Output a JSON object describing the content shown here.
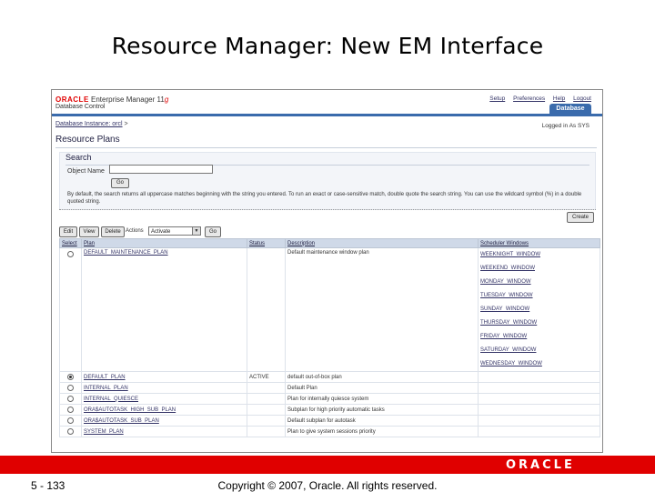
{
  "slide": {
    "title": "Resource Manager: New EM Interface",
    "page_number": "5 - 133",
    "copyright": "Copyright © 2007, Oracle. All rights reserved.",
    "footer_logo": "ORACLE"
  },
  "em": {
    "logo_oracle": "ORACLE",
    "logo_product": "Enterprise Manager 11",
    "logo_version": "g",
    "subtitle": "Database Control",
    "global_links": [
      "Setup",
      "Preferences",
      "Help",
      "Logout"
    ],
    "tab_label": "Database",
    "breadcrumb_link": "Database Instance: orcl",
    "breadcrumb_sep": ">",
    "logged_in": "Logged in As SYS",
    "page_title": "Resource Plans"
  },
  "search": {
    "heading": "Search",
    "name_label": "Object Name",
    "name_value": "",
    "go_label": "Go",
    "help_text": "By default, the search returns all uppercase matches beginning with the string you entered. To run an exact or case-sensitive match, double quote the search string. You can use the wildcard symbol (%) in a double quoted string."
  },
  "toolbar": {
    "create_label": "Create",
    "edit_label": "Edit",
    "view_label": "View",
    "delete_label": "Delete",
    "actions_label": "Actions",
    "actions_value": "Activate",
    "go_label": "Go"
  },
  "table": {
    "headers": [
      "Select",
      "Plan",
      "Status",
      "Description",
      "Scheduler Windows"
    ],
    "rows": [
      {
        "plan": "DEFAULT_MAINTENANCE_PLAN",
        "status": "",
        "description": "Default maintenance window plan",
        "windows": [
          "WEEKNIGHT_WINDOW",
          "WEEKEND_WINDOW",
          "MONDAY_WINDOW",
          "TUESDAY_WINDOW",
          "SUNDAY_WINDOW",
          "THURSDAY_WINDOW",
          "FRIDAY_WINDOW",
          "SATURDAY_WINDOW",
          "WEDNESDAY_WINDOW"
        ],
        "selected": false
      },
      {
        "plan": "DEFAULT_PLAN",
        "status": "ACTIVE",
        "description": "default out-of-box plan",
        "windows": [],
        "selected": true
      },
      {
        "plan": "INTERNAL_PLAN",
        "status": "",
        "description": "Default Plan",
        "windows": [],
        "selected": false
      },
      {
        "plan": "INTERNAL_QUIESCE",
        "status": "",
        "description": "Plan for internally quiesce system",
        "windows": [],
        "selected": false
      },
      {
        "plan": "ORA$AUTOTASK_HIGH_SUB_PLAN",
        "status": "",
        "description": "Subplan for high priority automatic tasks",
        "windows": [],
        "selected": false
      },
      {
        "plan": "ORA$AUTOTASK_SUB_PLAN",
        "status": "",
        "description": "Default subplan for autotask",
        "windows": [],
        "selected": false
      },
      {
        "plan": "SYSTEM_PLAN",
        "status": "",
        "description": "Plan to give system sessions priority",
        "windows": [],
        "selected": false
      }
    ]
  },
  "colors": {
    "oracle_red": "#e00000",
    "em_blue": "#3a6bac",
    "header_fill": "#cfd9e8"
  }
}
